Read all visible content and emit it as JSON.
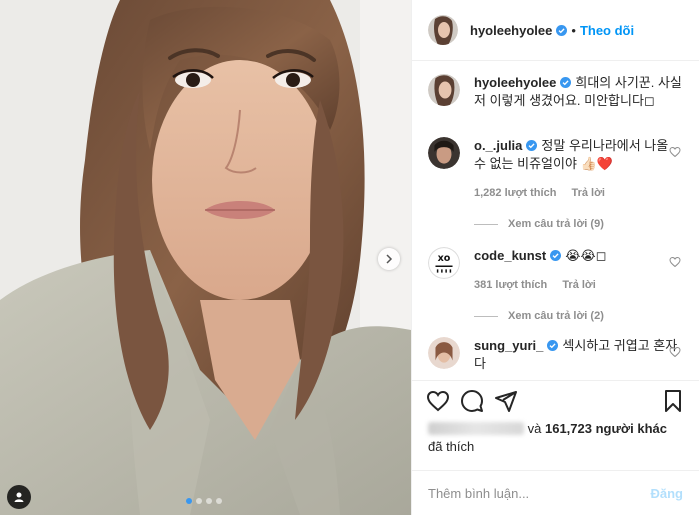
{
  "post": {
    "author": "hyoleehyolee",
    "follow_label": "Theo dõi",
    "separator": "•",
    "caption": "희대의 사기꾼. 사실 저 이렇게 생겼어요. 미안합니다◻",
    "slide_count": 4,
    "active_slide": 1
  },
  "comments": [
    {
      "username": "o._.julia",
      "text": "정말 우리나라에서 나올 수 없는 비쥬얼이야 👍🏻❤️",
      "likes": "1,282 lượt thích",
      "reply": "Trả lời",
      "view_replies": "Xem câu trả lời (9)"
    },
    {
      "username": "code_kunst",
      "text": "😭😭◻",
      "likes": "381 lượt thích",
      "reply": "Trả lời",
      "view_replies": "Xem câu trả lời (2)"
    },
    {
      "username": "sung_yuri_",
      "text": "섹시하고 귀엽고 혼자 다"
    }
  ],
  "likes_summary": {
    "and": "và",
    "count": "161,723 người khác",
    "liked": "đã thích"
  },
  "add_comment": {
    "placeholder": "Thêm bình luận...",
    "post_label": "Đăng"
  },
  "icons": {
    "like": "heart-outline-icon",
    "comment": "comment-bubble-icon",
    "share": "paper-plane-icon",
    "save": "bookmark-icon",
    "verified": "verified-badge-icon",
    "next": "chevron-right-icon",
    "tag": "user-tag-icon"
  },
  "colors": {
    "link_blue": "#0095f6",
    "verified_blue": "#3897f0",
    "muted": "#8e8e8e",
    "post_disabled": "#b2dffc"
  }
}
